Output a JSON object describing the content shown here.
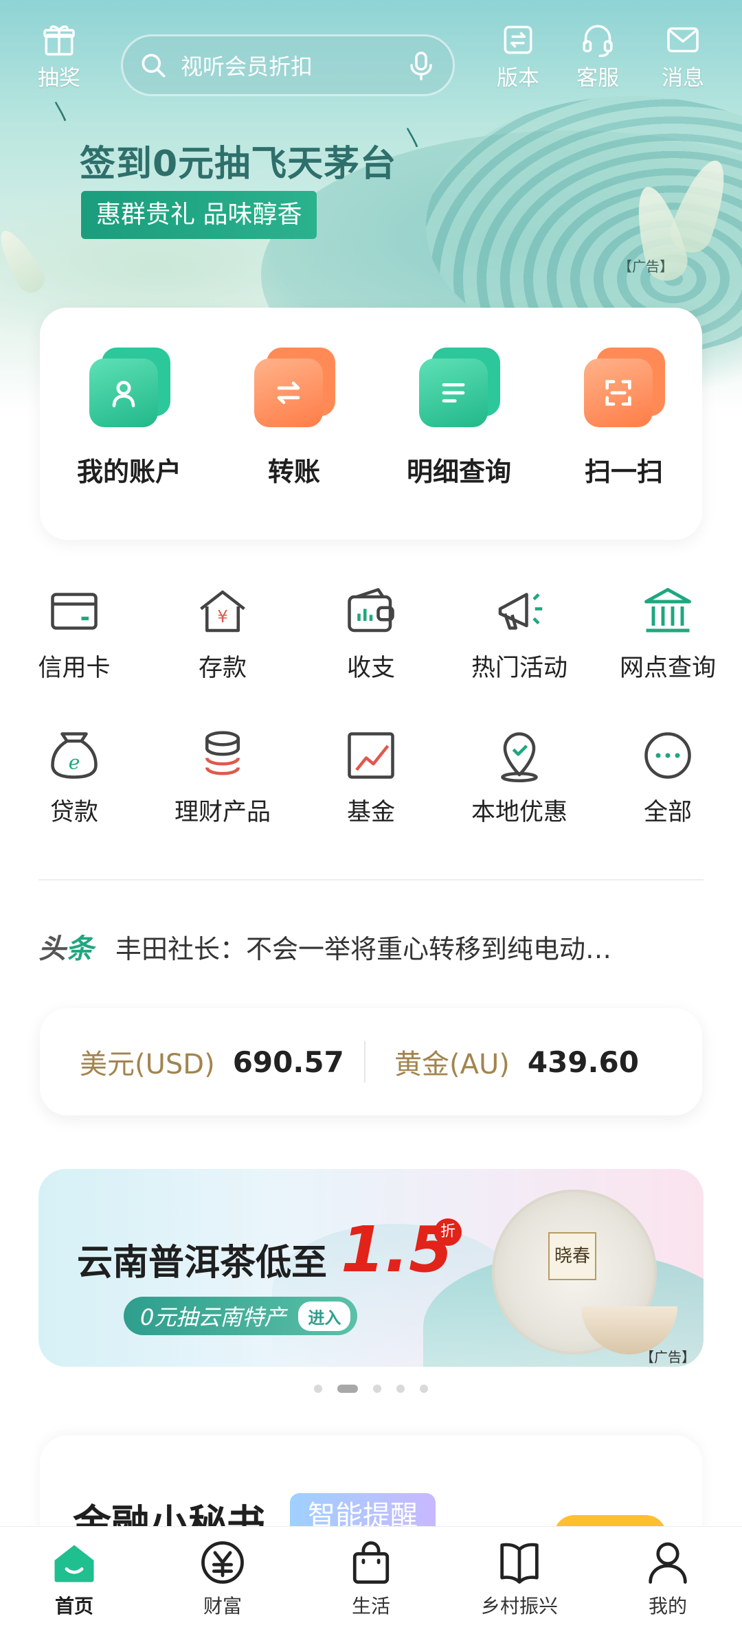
{
  "topbar": {
    "lottery_label": "抽奖",
    "search_placeholder": "视听会员折扣",
    "version_label": "版本",
    "service_label": "客服",
    "message_label": "消息"
  },
  "hero_ad": {
    "title": "签到0元抽飞天茅台",
    "tag": "惠群贵礼 品味醇香",
    "ad_mark": "【广告】"
  },
  "quick_actions": [
    {
      "label": "我的账户",
      "icon": "account-icon",
      "color": "green"
    },
    {
      "label": "转账",
      "icon": "transfer-icon",
      "color": "orange"
    },
    {
      "label": "明细查询",
      "icon": "details-icon",
      "color": "green"
    },
    {
      "label": "扫一扫",
      "icon": "scan-icon",
      "color": "orange"
    }
  ],
  "grid_row1": [
    {
      "label": "信用卡",
      "icon": "credit-card-icon"
    },
    {
      "label": "存款",
      "icon": "deposit-icon"
    },
    {
      "label": "收支",
      "icon": "income-expense-icon"
    },
    {
      "label": "热门活动",
      "icon": "megaphone-icon"
    },
    {
      "label": "网点查询",
      "icon": "bank-branch-icon"
    }
  ],
  "grid_row2": [
    {
      "label": "贷款",
      "icon": "loan-bag-icon"
    },
    {
      "label": "理财产品",
      "icon": "coin-stack-icon"
    },
    {
      "label": "基金",
      "icon": "fund-chart-icon"
    },
    {
      "label": "本地优惠",
      "icon": "location-pin-icon"
    },
    {
      "label": "全部",
      "icon": "more-icon"
    }
  ],
  "news": {
    "tag_prefix": "头",
    "tag_suffix": "条",
    "headline": "丰田社长：不会一举将重心转移到纯电动…"
  },
  "rates": [
    {
      "name": "美元(USD)",
      "value": "690.57"
    },
    {
      "name": "黄金(AU)",
      "value": "439.60"
    }
  ],
  "banner": {
    "title": "云南普洱茶低至",
    "discount": "1.5",
    "discount_unit": "折",
    "pill_text": "0元抽云南特产",
    "enter_label": "进入",
    "cake_label": "晓春",
    "ad_mark": "【广告】",
    "dots_total": 5,
    "dots_active_index": 1
  },
  "finance": {
    "title": "金融小秘书",
    "badge": "智能提醒"
  },
  "tabbar": [
    {
      "label": "首页",
      "icon": "home-icon",
      "active": true
    },
    {
      "label": "财富",
      "icon": "wealth-icon",
      "active": false
    },
    {
      "label": "生活",
      "icon": "shopping-bag-icon",
      "active": false
    },
    {
      "label": "乡村振兴",
      "icon": "book-icon",
      "active": false
    },
    {
      "label": "我的",
      "icon": "profile-icon",
      "active": false
    }
  ],
  "colors": {
    "brand_green": "#1fa77f",
    "accent_orange": "#ff7d47",
    "gold_text": "#a3844f"
  }
}
